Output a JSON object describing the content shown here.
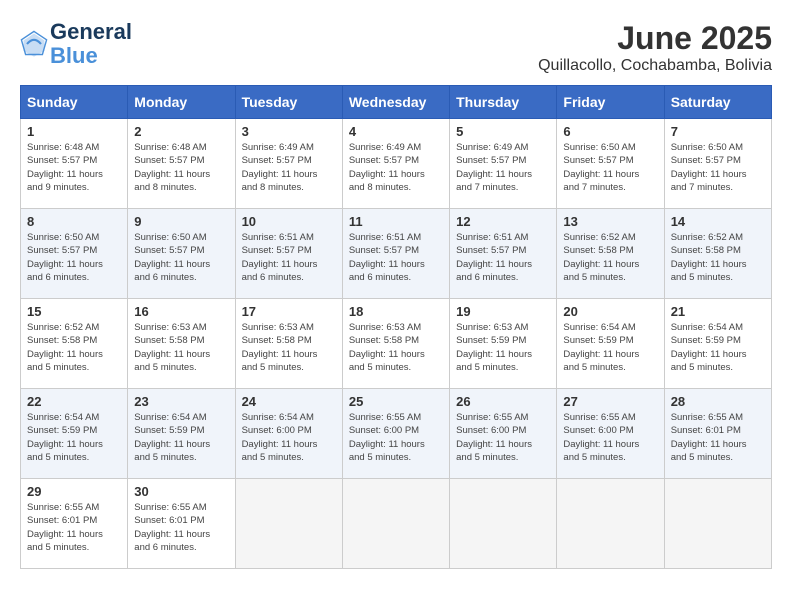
{
  "header": {
    "logo_line1": "General",
    "logo_line2": "Blue",
    "month": "June 2025",
    "location": "Quillacollo, Cochabamba, Bolivia"
  },
  "weekdays": [
    "Sunday",
    "Monday",
    "Tuesday",
    "Wednesday",
    "Thursday",
    "Friday",
    "Saturday"
  ],
  "weeks": [
    [
      {
        "day": "1",
        "sunrise": "6:48 AM",
        "sunset": "5:57 PM",
        "daylight": "11 hours and 9 minutes."
      },
      {
        "day": "2",
        "sunrise": "6:48 AM",
        "sunset": "5:57 PM",
        "daylight": "11 hours and 8 minutes."
      },
      {
        "day": "3",
        "sunrise": "6:49 AM",
        "sunset": "5:57 PM",
        "daylight": "11 hours and 8 minutes."
      },
      {
        "day": "4",
        "sunrise": "6:49 AM",
        "sunset": "5:57 PM",
        "daylight": "11 hours and 8 minutes."
      },
      {
        "day": "5",
        "sunrise": "6:49 AM",
        "sunset": "5:57 PM",
        "daylight": "11 hours and 7 minutes."
      },
      {
        "day": "6",
        "sunrise": "6:50 AM",
        "sunset": "5:57 PM",
        "daylight": "11 hours and 7 minutes."
      },
      {
        "day": "7",
        "sunrise": "6:50 AM",
        "sunset": "5:57 PM",
        "daylight": "11 hours and 7 minutes."
      }
    ],
    [
      {
        "day": "8",
        "sunrise": "6:50 AM",
        "sunset": "5:57 PM",
        "daylight": "11 hours and 6 minutes."
      },
      {
        "day": "9",
        "sunrise": "6:50 AM",
        "sunset": "5:57 PM",
        "daylight": "11 hours and 6 minutes."
      },
      {
        "day": "10",
        "sunrise": "6:51 AM",
        "sunset": "5:57 PM",
        "daylight": "11 hours and 6 minutes."
      },
      {
        "day": "11",
        "sunrise": "6:51 AM",
        "sunset": "5:57 PM",
        "daylight": "11 hours and 6 minutes."
      },
      {
        "day": "12",
        "sunrise": "6:51 AM",
        "sunset": "5:57 PM",
        "daylight": "11 hours and 6 minutes."
      },
      {
        "day": "13",
        "sunrise": "6:52 AM",
        "sunset": "5:58 PM",
        "daylight": "11 hours and 5 minutes."
      },
      {
        "day": "14",
        "sunrise": "6:52 AM",
        "sunset": "5:58 PM",
        "daylight": "11 hours and 5 minutes."
      }
    ],
    [
      {
        "day": "15",
        "sunrise": "6:52 AM",
        "sunset": "5:58 PM",
        "daylight": "11 hours and 5 minutes."
      },
      {
        "day": "16",
        "sunrise": "6:53 AM",
        "sunset": "5:58 PM",
        "daylight": "11 hours and 5 minutes."
      },
      {
        "day": "17",
        "sunrise": "6:53 AM",
        "sunset": "5:58 PM",
        "daylight": "11 hours and 5 minutes."
      },
      {
        "day": "18",
        "sunrise": "6:53 AM",
        "sunset": "5:58 PM",
        "daylight": "11 hours and 5 minutes."
      },
      {
        "day": "19",
        "sunrise": "6:53 AM",
        "sunset": "5:59 PM",
        "daylight": "11 hours and 5 minutes."
      },
      {
        "day": "20",
        "sunrise": "6:54 AM",
        "sunset": "5:59 PM",
        "daylight": "11 hours and 5 minutes."
      },
      {
        "day": "21",
        "sunrise": "6:54 AM",
        "sunset": "5:59 PM",
        "daylight": "11 hours and 5 minutes."
      }
    ],
    [
      {
        "day": "22",
        "sunrise": "6:54 AM",
        "sunset": "5:59 PM",
        "daylight": "11 hours and 5 minutes."
      },
      {
        "day": "23",
        "sunrise": "6:54 AM",
        "sunset": "5:59 PM",
        "daylight": "11 hours and 5 minutes."
      },
      {
        "day": "24",
        "sunrise": "6:54 AM",
        "sunset": "6:00 PM",
        "daylight": "11 hours and 5 minutes."
      },
      {
        "day": "25",
        "sunrise": "6:55 AM",
        "sunset": "6:00 PM",
        "daylight": "11 hours and 5 minutes."
      },
      {
        "day": "26",
        "sunrise": "6:55 AM",
        "sunset": "6:00 PM",
        "daylight": "11 hours and 5 minutes."
      },
      {
        "day": "27",
        "sunrise": "6:55 AM",
        "sunset": "6:00 PM",
        "daylight": "11 hours and 5 minutes."
      },
      {
        "day": "28",
        "sunrise": "6:55 AM",
        "sunset": "6:01 PM",
        "daylight": "11 hours and 5 minutes."
      }
    ],
    [
      {
        "day": "29",
        "sunrise": "6:55 AM",
        "sunset": "6:01 PM",
        "daylight": "11 hours and 5 minutes."
      },
      {
        "day": "30",
        "sunrise": "6:55 AM",
        "sunset": "6:01 PM",
        "daylight": "11 hours and 6 minutes."
      },
      null,
      null,
      null,
      null,
      null
    ]
  ],
  "labels": {
    "sunrise": "Sunrise:",
    "sunset": "Sunset:",
    "daylight": "Daylight:"
  }
}
